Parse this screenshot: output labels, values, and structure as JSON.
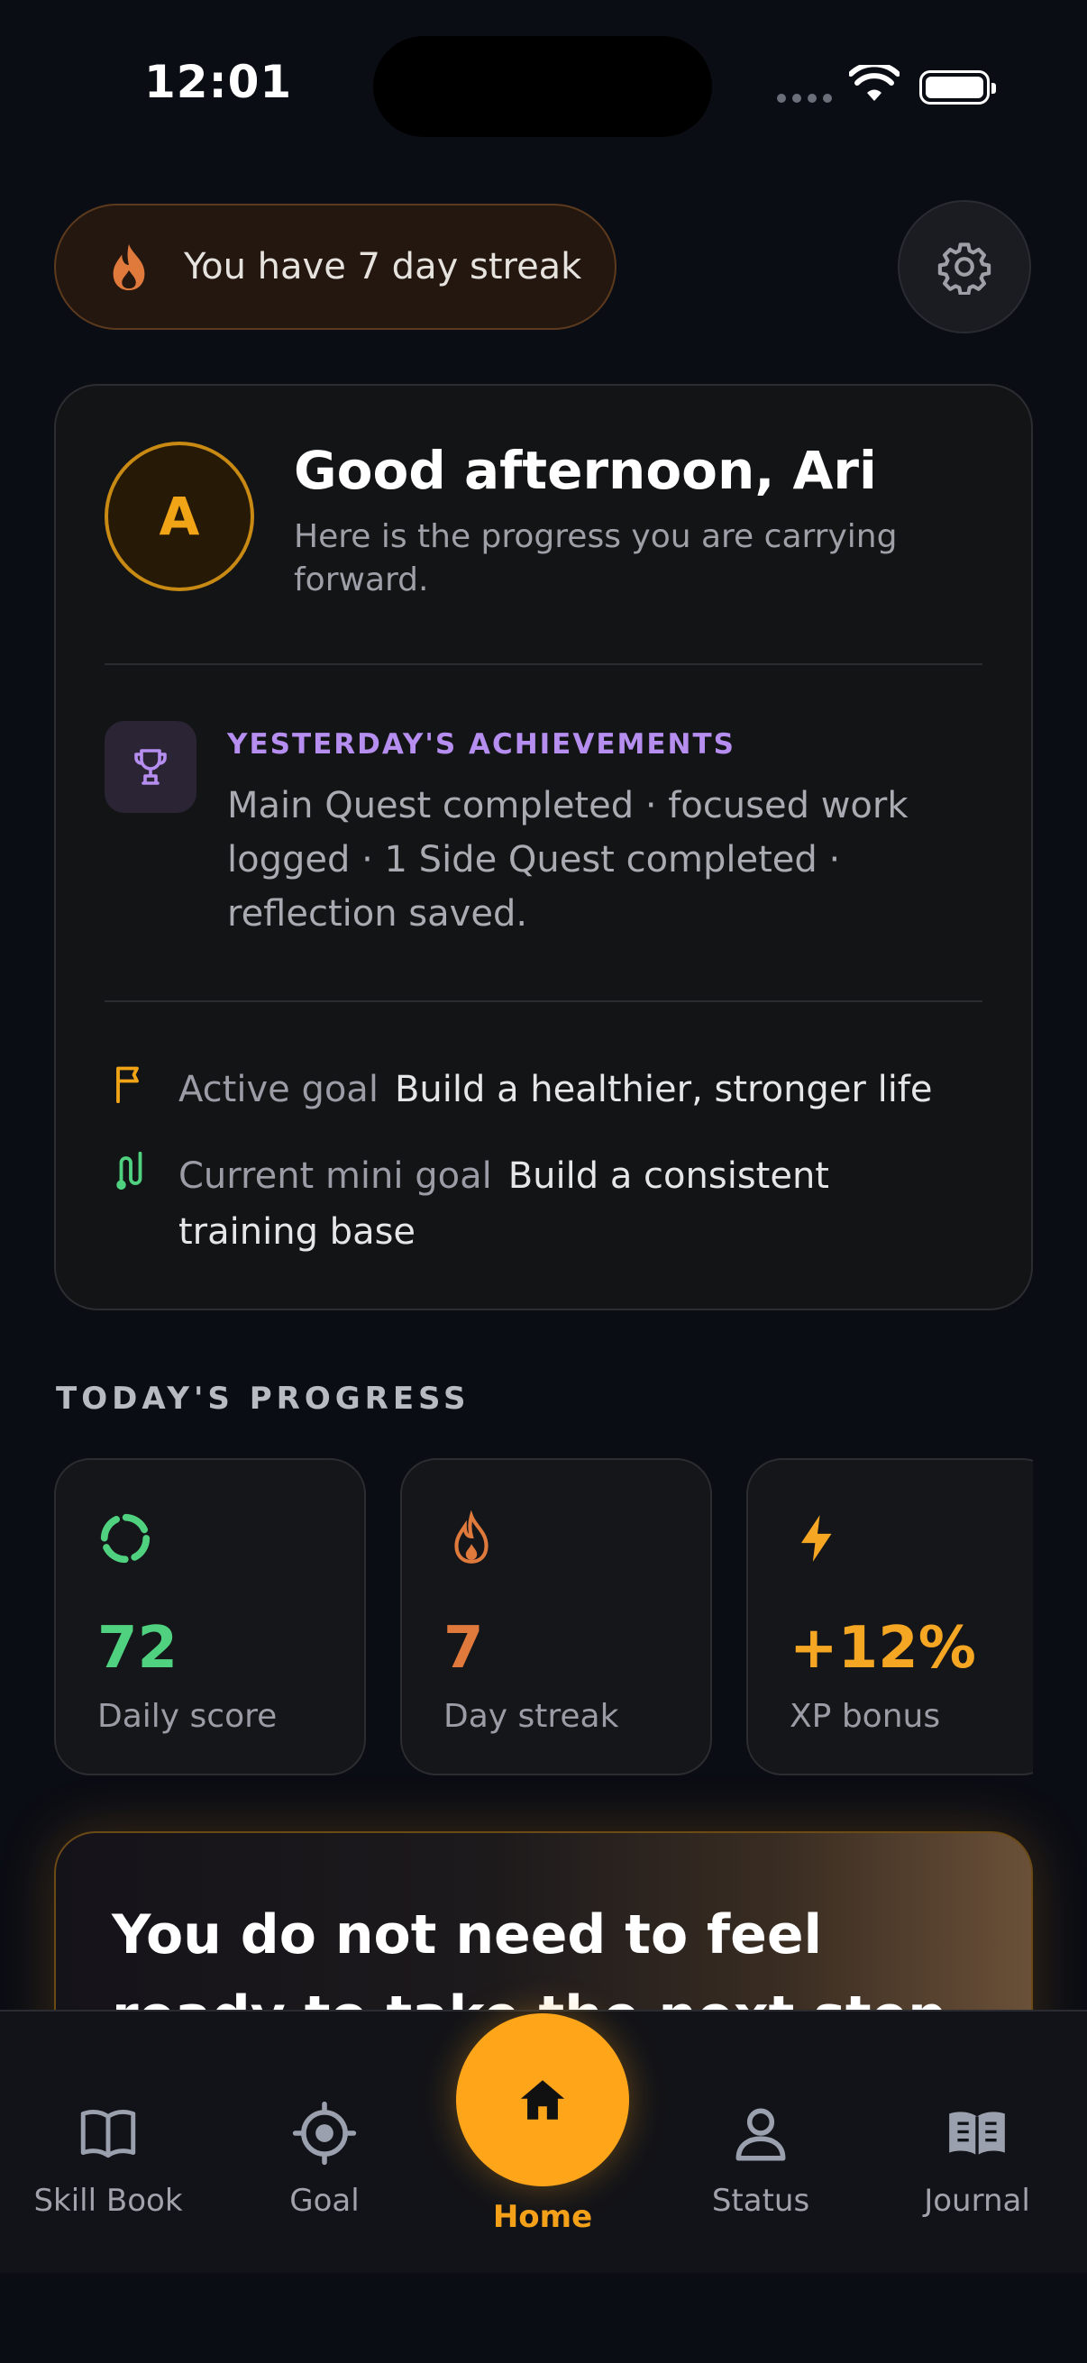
{
  "status_bar": {
    "time": "12:01"
  },
  "header": {
    "streak_text": "You have 7 day streak"
  },
  "greeting": {
    "avatar_initial": "A",
    "title": "Good afternoon, Ari",
    "subtitle": "Here is the progress you are carrying forward."
  },
  "achievements": {
    "title": "YESTERDAY'S ACHIEVEMENTS",
    "body": "Main Quest completed · focused work logged · 1 Side Quest completed · reflection saved."
  },
  "goals": {
    "active_label": "Active goal",
    "active_value": "Build a healthier, stronger life",
    "mini_label": "Current mini goal",
    "mini_value": "Build a consistent training base"
  },
  "progress": {
    "section_title": "TODAY'S PROGRESS",
    "stats": [
      {
        "value": "72",
        "label": "Daily score",
        "color": "#4fd17f",
        "icon": "circle-progress-icon"
      },
      {
        "value": "7",
        "label": "Day streak",
        "color": "#e07a3c",
        "icon": "flame-icon"
      },
      {
        "value": "+12%",
        "label": "XP bonus",
        "color": "#f5a623",
        "icon": "lightning-icon"
      }
    ]
  },
  "quote": {
    "text": "You do not need to feel ready to take the next step. Start"
  },
  "nav": {
    "items": [
      {
        "label": "Skill Book"
      },
      {
        "label": "Goal"
      },
      {
        "label": "Home"
      },
      {
        "label": "Status"
      },
      {
        "label": "Journal"
      }
    ],
    "active": "Home",
    "accent": "#ffa51a"
  }
}
